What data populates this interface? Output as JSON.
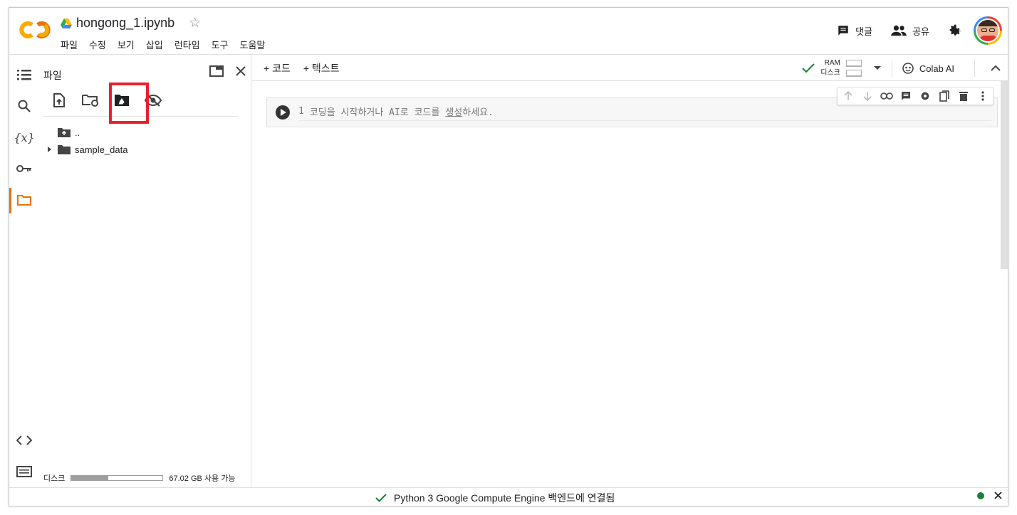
{
  "notebook": {
    "title": "hongong_1.ipynb"
  },
  "menu": [
    "파일",
    "수정",
    "보기",
    "삽입",
    "런타임",
    "도구",
    "도움말"
  ],
  "header_actions": {
    "comment_label": "댓글",
    "share_label": "공유"
  },
  "panel": {
    "title": "파일",
    "tree": [
      {
        "name": "..",
        "type": "parent-folder"
      },
      {
        "name": "sample_data",
        "type": "folder"
      }
    ],
    "disk": {
      "label": "디스크",
      "available": "67.02 GB 사용 가능",
      "used_fraction": 0.4
    }
  },
  "main_bar": {
    "add_code": "+ 코드",
    "add_text": "+ 텍스트",
    "ram_label": "RAM",
    "disk_label": "디스크",
    "colab_ai": "Colab AI"
  },
  "cell": {
    "line_number": "1",
    "placeholder_before": "코딩을 시작하거나 AI로 코드를",
    "placeholder_link": "생성",
    "placeholder_after": "하세요."
  },
  "status": {
    "text": "Python 3 Google Compute Engine 백엔드에 연결됨",
    "dot_color": "#188038"
  },
  "colors": {
    "accent_orange": "#e8710a",
    "highlight_red": "#e8202a",
    "check_green": "#188038"
  }
}
